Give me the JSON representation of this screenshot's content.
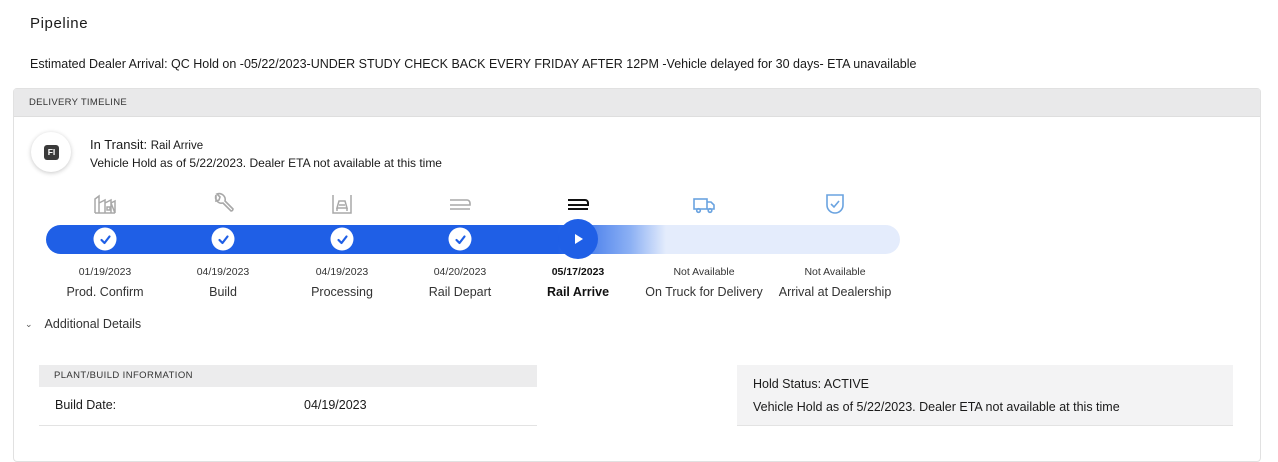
{
  "page": {
    "title": "Pipeline",
    "eta_text": "Estimated Dealer Arrival: QC Hold on -05/22/2023-UNDER STUDY CHECK BACK EVERY FRIDAY AFTER 12PM -Vehicle delayed for 30 days- ETA unavailable"
  },
  "timeline": {
    "header": "DELIVERY TIMELINE",
    "status_badge": "FI",
    "status_label": "In Transit:",
    "status_stage": "Rail Arrive",
    "status_message": "Vehicle Hold as of 5/22/2023. Dealer ETA not available at this time",
    "colors": {
      "accent": "#1f5fe6",
      "track_pending": "#e4ecfc",
      "pending_icon": "#6aa3e0",
      "done_icon": "#a8a8a8"
    },
    "stages": [
      {
        "icon": "factory-icon",
        "date": "01/19/2023",
        "label": "Prod. Confirm",
        "state": "done"
      },
      {
        "icon": "wrench-icon",
        "date": "04/19/2023",
        "label": "Build",
        "state": "done"
      },
      {
        "icon": "processing-icon",
        "date": "04/19/2023",
        "label": "Processing",
        "state": "done"
      },
      {
        "icon": "rail-icon",
        "date": "04/20/2023",
        "label": "Rail Depart",
        "state": "done"
      },
      {
        "icon": "rail-icon",
        "date": "05/17/2023",
        "label": "Rail Arrive",
        "state": "current"
      },
      {
        "icon": "truck-icon",
        "date": "Not Available",
        "label": "On Truck for Delivery",
        "state": "pending"
      },
      {
        "icon": "shield-check-icon",
        "date": "Not Available",
        "label": "Arrival at Dealership",
        "state": "pending"
      }
    ]
  },
  "details": {
    "toggle_label": "Additional Details",
    "plant": {
      "header": "PLANT/BUILD INFORMATION",
      "build_date_label": "Build Date:",
      "build_date_value": "04/19/2023"
    },
    "hold": {
      "status": "Hold Status: ACTIVE",
      "message": "Vehicle Hold as of 5/22/2023. Dealer ETA not available at this time"
    }
  }
}
